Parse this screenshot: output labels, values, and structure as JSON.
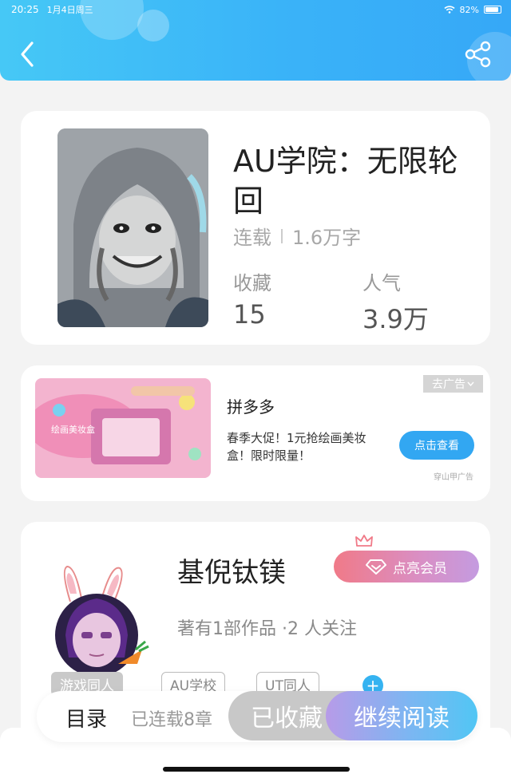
{
  "status_bar": {
    "time": "20:25",
    "date": "1月4日周三",
    "battery": "82%"
  },
  "book": {
    "title": "AU学院：无限轮回",
    "status": "连载",
    "word_count": "1.6万字",
    "favorites_label": "收藏",
    "favorites_value": "15",
    "popularity_label": "人气",
    "popularity_value": "3.9万"
  },
  "ad": {
    "close_label": "去广告",
    "name": "拼多多",
    "description": "春季大促！1元抢绘画美妆盒！限时限量！",
    "button_label": "点击查看",
    "source": "穿山甲广告",
    "image_text": "绘画美妆盒"
  },
  "author": {
    "name": "基倪钛镁",
    "vip_button_label": "点亮会员",
    "info": "著有1部作品 ·2 人关注",
    "tags": [
      "游戏同人",
      "AU学校",
      "UT同人"
    ],
    "add_tag_symbol": "+"
  },
  "bottom_bar": {
    "toc_label": "目录",
    "progress_label": "已连载8章",
    "favorited_label": "已收藏",
    "continue_label": "继续阅读"
  },
  "colors": {
    "header_blue": "#3ab3f8",
    "ad_button": "#32a7f2",
    "tag_add": "#35b3f1"
  },
  "icons": [
    "back-arrow-icon",
    "share-icon",
    "wifi-icon",
    "battery-icon",
    "diamond-icon",
    "crown-icon",
    "chevron-down-icon"
  ]
}
